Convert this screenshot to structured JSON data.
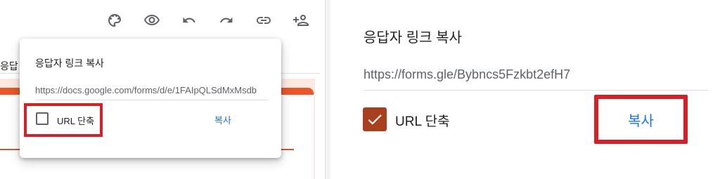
{
  "toolbar": {
    "icons": [
      "palette-icon",
      "eye-icon",
      "undo-icon",
      "redo-icon",
      "link-icon",
      "add-person-icon"
    ]
  },
  "left": {
    "background_peek_text": "응답",
    "popup": {
      "title": "응답자 링크 복사",
      "url": "https://docs.google.com/forms/d/e/1FAIpQLSdMxMsdb",
      "shorten_label": "URL 단축",
      "shorten_checked": false,
      "copy_label": "복사"
    }
  },
  "right": {
    "title": "응답자 링크 복사",
    "url": "https://forms.gle/Bybncs5Fzkbt2efH7",
    "shorten_label": "URL 단축",
    "shorten_checked": true,
    "copy_label": "복사"
  },
  "colors": {
    "accent_blue": "#1a73e8",
    "highlight_red": "#d61f26",
    "form_theme": "#e8562a",
    "checkbox_checked": "#a8401f"
  }
}
